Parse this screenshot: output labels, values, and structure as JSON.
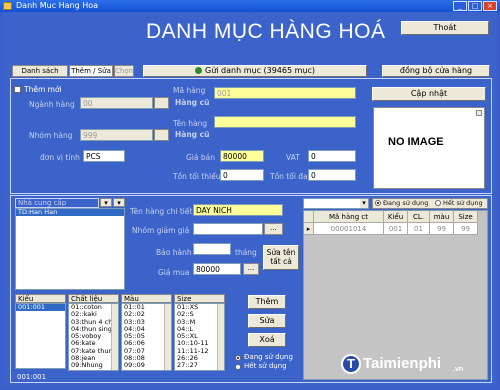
{
  "window": {
    "title": "Danh Muc Hang Hoa"
  },
  "header": {
    "title": "DANH MỤC HÀNG HOÁ",
    "exit_label": "Thoát"
  },
  "tabs": [
    {
      "label": "Danh sách hàng"
    },
    {
      "label": "Thêm / Sửa"
    },
    {
      "label": "Chọn"
    }
  ],
  "toolbar": {
    "send_label": "Gửi danh mục (39465 mục)",
    "sync_label": "đồng bộ cửa hàng"
  },
  "form": {
    "new_label": "Thêm mới",
    "category_label": "Ngành hàng",
    "category_value": "00",
    "category_name": "Hàng cũ",
    "group_label": "Nhóm hàng",
    "group_value": "999",
    "group_name": "Hàng cũ",
    "code_label": "Mã hàng",
    "code_value": "001",
    "name_label": "Tên hàng",
    "name_value": "",
    "unit_label": "đơn vị tính",
    "unit_value": "PCS",
    "price_label": "Giá bán",
    "price_value": "80000",
    "vat_label": "VAT",
    "vat_value": "0",
    "min_stock_label": "Tồn tối thiểu",
    "min_stock_value": "0",
    "max_stock_label": "Tồn tối đa",
    "max_stock_value": "0",
    "update_label": "Cập nhật",
    "no_image_text": "NO IMAGE"
  },
  "supplier": {
    "header_label": "Nhà cung cấp",
    "items": [
      "TD:Han Han"
    ]
  },
  "detail": {
    "detail_name_label": "Tên hàng chi tiết",
    "detail_name_value": "DAY NICH",
    "discount_group_label": "Nhóm giảm giá",
    "warranty_label": "Bảo hành",
    "warranty_unit": "tháng",
    "buy_price_label": "Giá mua",
    "buy_price_value": "80000",
    "edit_all_label": "Sửa tên tất cả",
    "add_label": "Thêm",
    "edit_label": "Sửa",
    "delete_label": "Xoá",
    "radio_in_use": "Đang sử dụng",
    "radio_not_in_use": "Hết sử dụng"
  },
  "attributes": {
    "type": {
      "header": "Kiểu",
      "items": [
        "001:001"
      ],
      "footer": "001:001"
    },
    "material": {
      "header": "Chất liệu",
      "items": [
        "01::coton",
        "02::kaki",
        "03:thun 4 chi",
        "04:thun single",
        "05:voboy",
        "06:kate",
        "07:kate thun",
        "08:jean",
        "09:Nhung"
      ]
    },
    "color": {
      "header": "Màu",
      "items": [
        "01::01",
        "02::02",
        "03::03",
        "04::04",
        "05::05",
        "06::06",
        "07::07",
        "08::08",
        "09::09"
      ]
    },
    "size": {
      "header": "Size",
      "items": [
        "01::XS",
        "02::S",
        "03::M",
        "04::L",
        "05::XL",
        "10::10-11",
        "11::11-12",
        "26::26",
        "27::27"
      ]
    }
  },
  "variants": {
    "radio_in_use": "Đang sử dụng",
    "radio_not_in_use": "Hết sử dụng",
    "columns": [
      "Mã hàng ct",
      "Kiểu",
      "CL.",
      "màu",
      "Size"
    ],
    "rows": [
      [
        "00001014",
        "001",
        "01",
        "99",
        "99"
      ]
    ]
  },
  "watermark": {
    "brand": "Taimienphi",
    "suffix": ".vn"
  }
}
